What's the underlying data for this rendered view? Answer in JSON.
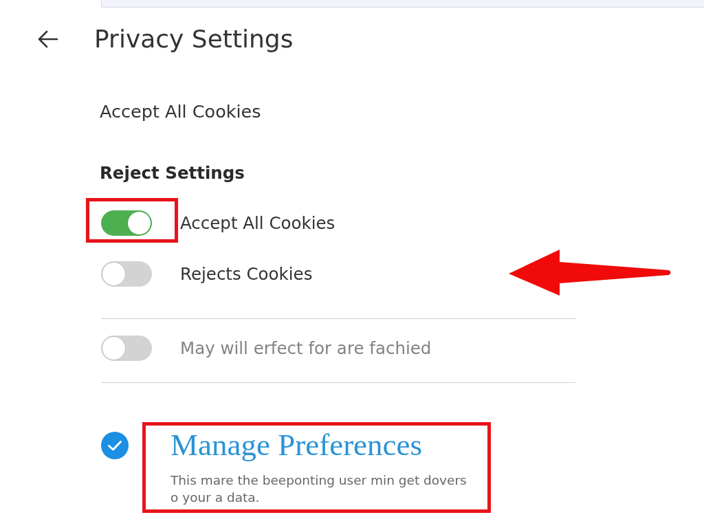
{
  "header": {
    "title": "Privacy Settings"
  },
  "top_option": "Accept All Cookies",
  "section": {
    "heading": "Reject Settings",
    "toggle_groups": [
      {
        "items": [
          {
            "label": "Accept All Cookies",
            "on": true,
            "disabled": false,
            "highlighted": true,
            "arrow": false
          },
          {
            "label": "Rejects Cookies",
            "on": false,
            "disabled": false,
            "highlighted": false,
            "arrow": true
          }
        ]
      },
      {
        "items": [
          {
            "label": "May will erfect for are fachied",
            "on": false,
            "disabled": true,
            "highlighted": false,
            "arrow": false
          }
        ]
      }
    ]
  },
  "preferences": {
    "checked": true,
    "highlighted": true,
    "title": "Manage Preferences",
    "description": "This mare the beeponting user min get dovers o your a data."
  }
}
